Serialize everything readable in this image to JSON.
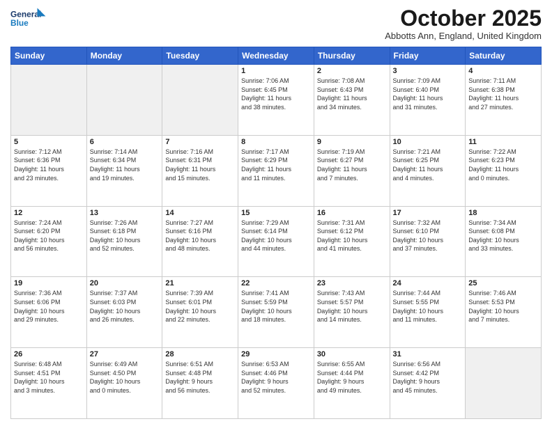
{
  "header": {
    "logo_line1": "General",
    "logo_line2": "Blue",
    "month": "October 2025",
    "location": "Abbotts Ann, England, United Kingdom"
  },
  "days_of_week": [
    "Sunday",
    "Monday",
    "Tuesday",
    "Wednesday",
    "Thursday",
    "Friday",
    "Saturday"
  ],
  "weeks": [
    [
      {
        "day": "",
        "info": ""
      },
      {
        "day": "",
        "info": ""
      },
      {
        "day": "",
        "info": ""
      },
      {
        "day": "1",
        "info": "Sunrise: 7:06 AM\nSunset: 6:45 PM\nDaylight: 11 hours\nand 38 minutes."
      },
      {
        "day": "2",
        "info": "Sunrise: 7:08 AM\nSunset: 6:43 PM\nDaylight: 11 hours\nand 34 minutes."
      },
      {
        "day": "3",
        "info": "Sunrise: 7:09 AM\nSunset: 6:40 PM\nDaylight: 11 hours\nand 31 minutes."
      },
      {
        "day": "4",
        "info": "Sunrise: 7:11 AM\nSunset: 6:38 PM\nDaylight: 11 hours\nand 27 minutes."
      }
    ],
    [
      {
        "day": "5",
        "info": "Sunrise: 7:12 AM\nSunset: 6:36 PM\nDaylight: 11 hours\nand 23 minutes."
      },
      {
        "day": "6",
        "info": "Sunrise: 7:14 AM\nSunset: 6:34 PM\nDaylight: 11 hours\nand 19 minutes."
      },
      {
        "day": "7",
        "info": "Sunrise: 7:16 AM\nSunset: 6:31 PM\nDaylight: 11 hours\nand 15 minutes."
      },
      {
        "day": "8",
        "info": "Sunrise: 7:17 AM\nSunset: 6:29 PM\nDaylight: 11 hours\nand 11 minutes."
      },
      {
        "day": "9",
        "info": "Sunrise: 7:19 AM\nSunset: 6:27 PM\nDaylight: 11 hours\nand 7 minutes."
      },
      {
        "day": "10",
        "info": "Sunrise: 7:21 AM\nSunset: 6:25 PM\nDaylight: 11 hours\nand 4 minutes."
      },
      {
        "day": "11",
        "info": "Sunrise: 7:22 AM\nSunset: 6:23 PM\nDaylight: 11 hours\nand 0 minutes."
      }
    ],
    [
      {
        "day": "12",
        "info": "Sunrise: 7:24 AM\nSunset: 6:20 PM\nDaylight: 10 hours\nand 56 minutes."
      },
      {
        "day": "13",
        "info": "Sunrise: 7:26 AM\nSunset: 6:18 PM\nDaylight: 10 hours\nand 52 minutes."
      },
      {
        "day": "14",
        "info": "Sunrise: 7:27 AM\nSunset: 6:16 PM\nDaylight: 10 hours\nand 48 minutes."
      },
      {
        "day": "15",
        "info": "Sunrise: 7:29 AM\nSunset: 6:14 PM\nDaylight: 10 hours\nand 44 minutes."
      },
      {
        "day": "16",
        "info": "Sunrise: 7:31 AM\nSunset: 6:12 PM\nDaylight: 10 hours\nand 41 minutes."
      },
      {
        "day": "17",
        "info": "Sunrise: 7:32 AM\nSunset: 6:10 PM\nDaylight: 10 hours\nand 37 minutes."
      },
      {
        "day": "18",
        "info": "Sunrise: 7:34 AM\nSunset: 6:08 PM\nDaylight: 10 hours\nand 33 minutes."
      }
    ],
    [
      {
        "day": "19",
        "info": "Sunrise: 7:36 AM\nSunset: 6:06 PM\nDaylight: 10 hours\nand 29 minutes."
      },
      {
        "day": "20",
        "info": "Sunrise: 7:37 AM\nSunset: 6:03 PM\nDaylight: 10 hours\nand 26 minutes."
      },
      {
        "day": "21",
        "info": "Sunrise: 7:39 AM\nSunset: 6:01 PM\nDaylight: 10 hours\nand 22 minutes."
      },
      {
        "day": "22",
        "info": "Sunrise: 7:41 AM\nSunset: 5:59 PM\nDaylight: 10 hours\nand 18 minutes."
      },
      {
        "day": "23",
        "info": "Sunrise: 7:43 AM\nSunset: 5:57 PM\nDaylight: 10 hours\nand 14 minutes."
      },
      {
        "day": "24",
        "info": "Sunrise: 7:44 AM\nSunset: 5:55 PM\nDaylight: 10 hours\nand 11 minutes."
      },
      {
        "day": "25",
        "info": "Sunrise: 7:46 AM\nSunset: 5:53 PM\nDaylight: 10 hours\nand 7 minutes."
      }
    ],
    [
      {
        "day": "26",
        "info": "Sunrise: 6:48 AM\nSunset: 4:51 PM\nDaylight: 10 hours\nand 3 minutes."
      },
      {
        "day": "27",
        "info": "Sunrise: 6:49 AM\nSunset: 4:50 PM\nDaylight: 10 hours\nand 0 minutes."
      },
      {
        "day": "28",
        "info": "Sunrise: 6:51 AM\nSunset: 4:48 PM\nDaylight: 9 hours\nand 56 minutes."
      },
      {
        "day": "29",
        "info": "Sunrise: 6:53 AM\nSunset: 4:46 PM\nDaylight: 9 hours\nand 52 minutes."
      },
      {
        "day": "30",
        "info": "Sunrise: 6:55 AM\nSunset: 4:44 PM\nDaylight: 9 hours\nand 49 minutes."
      },
      {
        "day": "31",
        "info": "Sunrise: 6:56 AM\nSunset: 4:42 PM\nDaylight: 9 hours\nand 45 minutes."
      },
      {
        "day": "",
        "info": ""
      }
    ]
  ]
}
